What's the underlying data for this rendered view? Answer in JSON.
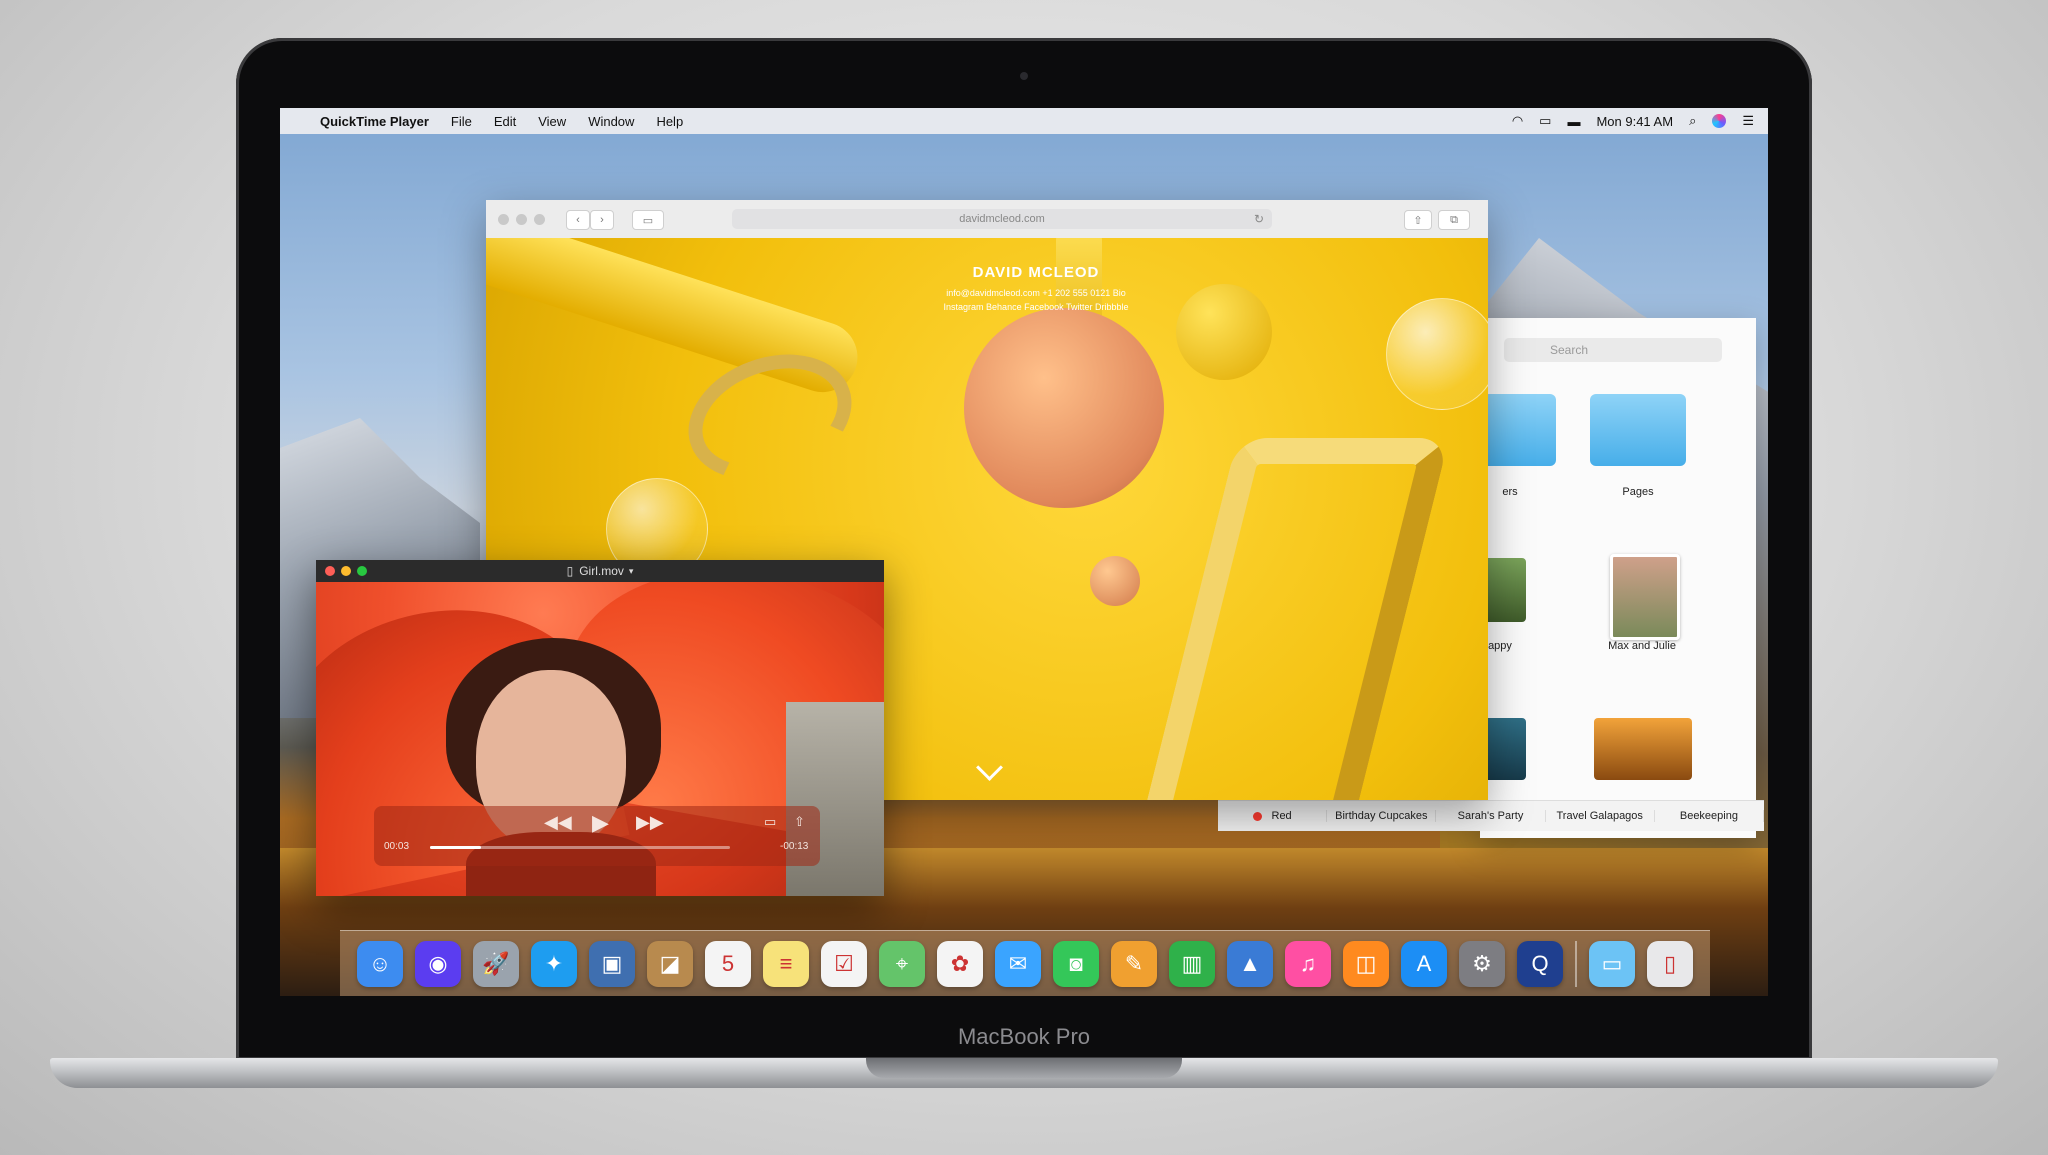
{
  "menubar": {
    "apple_glyph": "",
    "app_name": "QuickTime Player",
    "items": [
      "File",
      "Edit",
      "View",
      "Window",
      "Help"
    ],
    "clock": "Mon 9:41 AM"
  },
  "safari": {
    "url": "davidmcleod.com",
    "site_title": "DAVID MCLEOD",
    "site_contact": "info@davidmcleod.com  +1 202 555 0121  Bio",
    "site_links": "Instagram  Behance  Facebook  Twitter  Dribbble"
  },
  "finder": {
    "search_placeholder": "Search",
    "items": [
      {
        "label": "ers",
        "kind": "folder"
      },
      {
        "label": "Pages",
        "kind": "folder"
      },
      {
        "label": "appy",
        "kind": "photo"
      },
      {
        "label": "Max and Julie",
        "kind": "photo"
      },
      {
        "label": "",
        "kind": "photo"
      },
      {
        "label": "",
        "kind": "photo"
      }
    ],
    "tags": [
      "Red",
      "Birthday Cupcakes",
      "Sarah's Party",
      "Travel Galapagos",
      "Beekeeping"
    ]
  },
  "quicktime": {
    "filename": "Girl.mov",
    "elapsed": "00:03",
    "remaining": "-00:13",
    "progress": 0.17
  },
  "dock": {
    "apps": [
      {
        "name": "Finder",
        "icon": "finder-icon",
        "color": "#3d8cf0"
      },
      {
        "name": "Siri",
        "icon": "siri-icon",
        "color": "#5b3df0"
      },
      {
        "name": "Launchpad",
        "icon": "launchpad-icon",
        "color": "#9aa3ad"
      },
      {
        "name": "Safari",
        "icon": "safari-icon",
        "color": "#1e9df0"
      },
      {
        "name": "Photo Booth",
        "icon": "photo-booth-icon",
        "color": "#3f6fb0"
      },
      {
        "name": "Contacts",
        "icon": "contacts-icon",
        "color": "#b88a4e"
      },
      {
        "name": "Calendar",
        "icon": "calendar-icon",
        "color": "#f4f4f4"
      },
      {
        "name": "Notes",
        "icon": "notes-icon",
        "color": "#f7e27a"
      },
      {
        "name": "Reminders",
        "icon": "reminders-icon",
        "color": "#f4f4f4"
      },
      {
        "name": "Maps",
        "icon": "maps-icon",
        "color": "#64c46a"
      },
      {
        "name": "Photos",
        "icon": "photos-icon",
        "color": "#f4f4f4"
      },
      {
        "name": "Messages",
        "icon": "messages-icon",
        "color": "#3aa4ff"
      },
      {
        "name": "FaceTime",
        "icon": "facetime-icon",
        "color": "#34c759"
      },
      {
        "name": "Pages",
        "icon": "pages-icon",
        "color": "#f0a030"
      },
      {
        "name": "Numbers",
        "icon": "numbers-icon",
        "color": "#2fb14a"
      },
      {
        "name": "Keynote",
        "icon": "keynote-icon",
        "color": "#3a7bd5"
      },
      {
        "name": "iTunes",
        "icon": "itunes-icon",
        "color": "#ff4fa3"
      },
      {
        "name": "iBooks",
        "icon": "ibooks-icon",
        "color": "#ff8a1f"
      },
      {
        "name": "App Store",
        "icon": "app-store-icon",
        "color": "#1c8ef5"
      },
      {
        "name": "System Preferences",
        "icon": "system-preferences-icon",
        "color": "#7d7d82"
      },
      {
        "name": "QuickTime Player",
        "icon": "quicktime-icon",
        "color": "#1f3f8f"
      }
    ],
    "extras": [
      {
        "name": "Downloads",
        "icon": "downloads-folder-icon",
        "color": "#6cc3f5"
      },
      {
        "name": "Trash",
        "icon": "trash-icon",
        "color": "#e8e8ea"
      }
    ]
  },
  "device": {
    "label": "MacBook Pro"
  }
}
